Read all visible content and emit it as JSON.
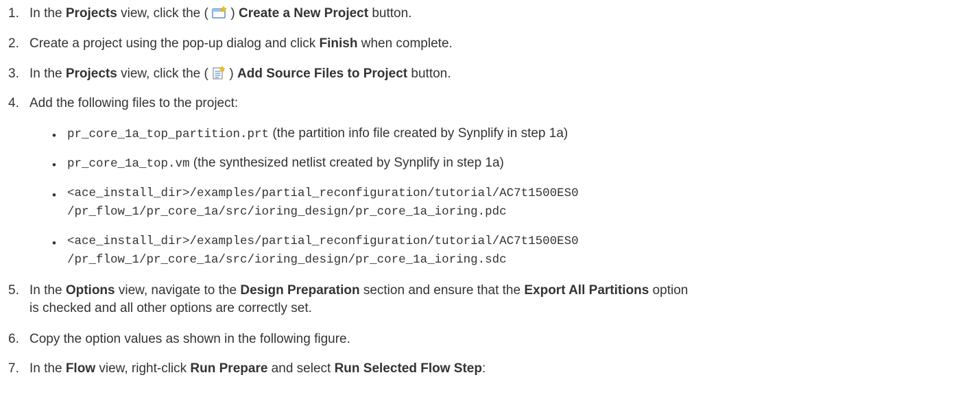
{
  "steps": [
    {
      "num": "1.",
      "t1": "In the ",
      "b1": "Projects",
      "t2": " view, click the ( ",
      "icon": "create-project-icon",
      "t3": " ) ",
      "b2": "Create a New Project",
      "t4": " button."
    },
    {
      "num": "2.",
      "t1": "Create a project using the pop-up dialog and click ",
      "b1": "Finish",
      "t2": " when complete."
    },
    {
      "num": "3.",
      "t1": "In the ",
      "b1": "Projects",
      "t2": " view, click the ( ",
      "icon": "add-source-files-icon",
      "t3": " ) ",
      "b2": "Add Source Files to Project",
      "t4": " button."
    },
    {
      "num": "4.",
      "t1": "Add the following files to the project:"
    },
    {
      "num": "5.",
      "t1": "In the ",
      "b1": "Options",
      "t2": " view, navigate to the ",
      "b2": "Design Preparation",
      "t3": " section and ensure that the ",
      "b3": "Export All Partitions",
      "t4": " option",
      "t5": "is checked and all other options are correctly set."
    },
    {
      "num": "6.",
      "t1": "Copy the option values as shown in the following figure."
    },
    {
      "num": "7.",
      "t1": "In the ",
      "b1": "Flow",
      "t2": " view, right-click ",
      "b2": "Run Prepare",
      "t3": " and select ",
      "b3": "Run Selected Flow Step",
      "t4": ":"
    }
  ],
  "files": [
    {
      "code": "pr_core_1a_top_partition.prt",
      "desc": " (the partition info file created by Synplify in step 1a)"
    },
    {
      "code": "pr_core_1a_top.vm",
      "desc": " (the synthesized netlist created by Synplify in step 1a)"
    },
    {
      "code1": "<ace_install_dir>/examples/partial_reconfiguration/tutorial/AC7t1500ES0",
      "code2": "/pr_flow_1/pr_core_1a/src/ioring_design/pr_core_1a_ioring.pdc"
    },
    {
      "code1": "<ace_install_dir>/examples/partial_reconfiguration/tutorial/AC7t1500ES0",
      "code2": "/pr_flow_1/pr_core_1a/src/ioring_design/pr_core_1a_ioring.sdc"
    }
  ],
  "bullet_char": "•",
  "colors": {
    "text": "#333333",
    "icon_blue": "#5b8ec9",
    "icon_star": "#f2c300"
  }
}
